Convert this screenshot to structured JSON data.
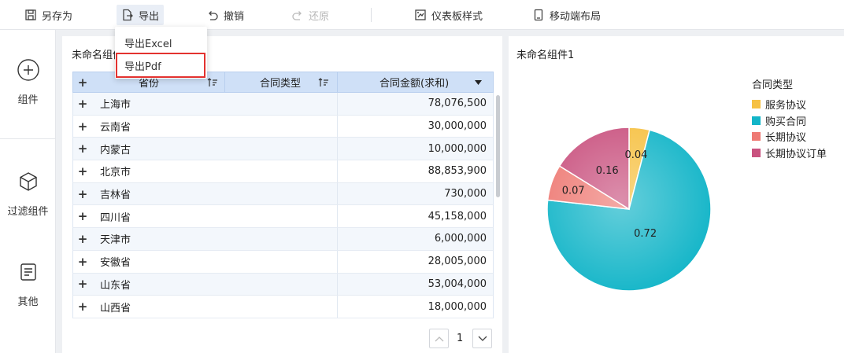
{
  "toolbar": {
    "save_as": "另存为",
    "export": "导出",
    "undo": "撤销",
    "redo": "还原",
    "dashboard_style": "仪表板样式",
    "mobile_layout": "移动端布局"
  },
  "export_menu": {
    "items": [
      "导出Excel",
      "导出Pdf"
    ],
    "highlighted": "导出Pdf"
  },
  "rail": {
    "items": [
      {
        "label": "组件",
        "icon": "plus-circle-icon"
      },
      {
        "label": "过滤组件",
        "icon": "cube-icon"
      },
      {
        "label": "其他",
        "icon": "document-icon"
      }
    ]
  },
  "table_panel": {
    "title": "未命名组件",
    "columns": [
      "省份",
      "合同类型",
      "合同金额(求和)"
    ],
    "rows": [
      {
        "province": "上海市",
        "amount": "78,076,500"
      },
      {
        "province": "云南省",
        "amount": "30,000,000"
      },
      {
        "province": "内蒙古",
        "amount": "10,000,000"
      },
      {
        "province": "北京市",
        "amount": "88,853,900"
      },
      {
        "province": "吉林省",
        "amount": "730,000"
      },
      {
        "province": "四川省",
        "amount": "45,158,000"
      },
      {
        "province": "天津市",
        "amount": "6,000,000"
      },
      {
        "province": "安徽省",
        "amount": "28,005,000"
      },
      {
        "province": "山东省",
        "amount": "53,004,000"
      },
      {
        "province": "山西省",
        "amount": "18,000,000"
      }
    ],
    "page": "1"
  },
  "chart_panel": {
    "title": "未命名组件1"
  },
  "chart_data": {
    "type": "pie",
    "legend_title": "合同类型",
    "legend_position": "right",
    "slices": [
      {
        "name": "服务协议",
        "value": 0.04,
        "label": "0.04",
        "color": "#f6c143"
      },
      {
        "name": "购买合同",
        "value": 0.72,
        "label": "0.72",
        "color": "#13b5c8"
      },
      {
        "name": "长期协议",
        "value": 0.07,
        "label": "0.07",
        "color": "#ee7a74"
      },
      {
        "name": "长期协议订单",
        "value": 0.16,
        "label": "0.16",
        "color": "#c9527f"
      }
    ]
  },
  "colors": {
    "accent": "#3b7fe0",
    "highlight_border": "#e3322f",
    "header_bg": "#cfe0f7"
  }
}
